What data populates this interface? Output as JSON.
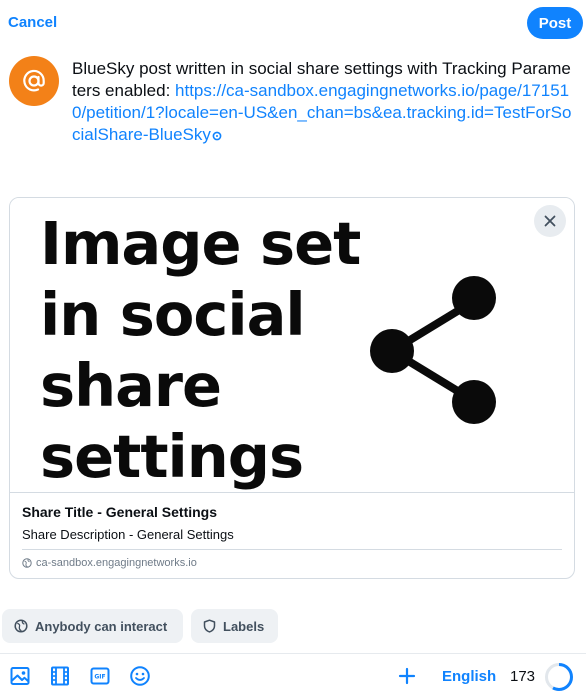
{
  "header": {
    "cancel_label": "Cancel",
    "post_label": "Post"
  },
  "composer": {
    "avatar_icon": "at-sign-icon",
    "text_plain": "BlueSky post written in social share settings with Tracking Parameters enabled: ",
    "text_link": "https://ca-sandbox.engagingnetworks.io/page/171510/petition/1?locale=en-US&en_chan=bs&ea.tracking.id=TestForSocialShare-BlueSky"
  },
  "link_card": {
    "image_text": [
      "Image set",
      "in social",
      "share",
      "settings"
    ],
    "image_icon": "share-icon",
    "close_icon": "close-icon",
    "title": "Share Title - General Settings",
    "description": "Share Description - General Settings",
    "domain": "ca-sandbox.engagingnetworks.io"
  },
  "settings_pills": {
    "interaction_label": "Anybody can interact",
    "labels_label": "Labels"
  },
  "toolbar": {
    "icons": [
      "image-icon",
      "video-icon",
      "gif-icon",
      "emoji-icon"
    ],
    "add_icon": "plus-icon",
    "language": "English",
    "char_count": "173"
  },
  "colors": {
    "accent": "#1083fe",
    "avatar": "#f38118",
    "pill_bg": "#eef1f4",
    "border": "#d4dbe2"
  }
}
